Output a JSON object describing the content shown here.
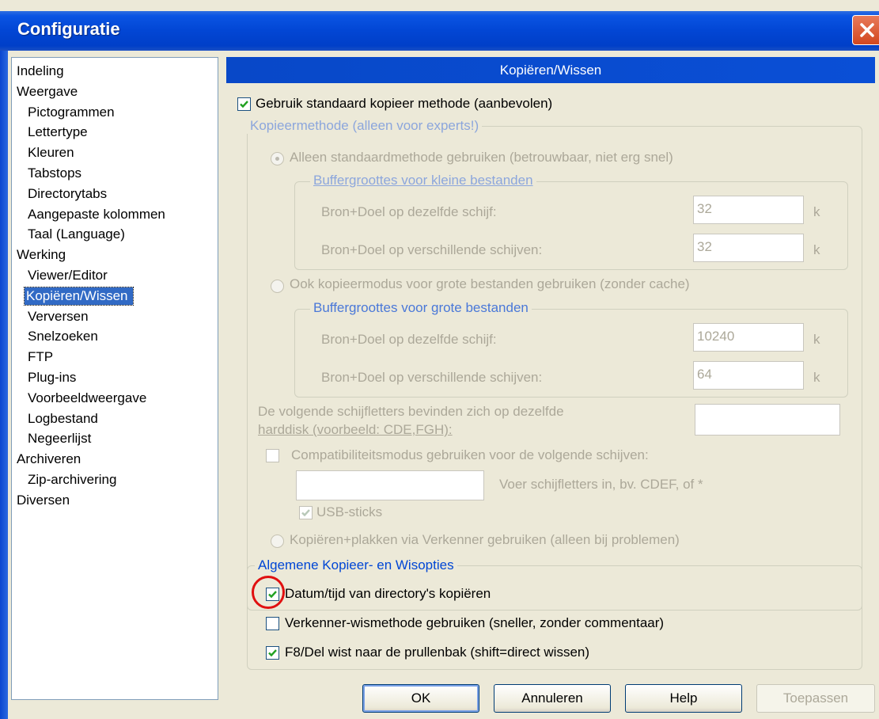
{
  "window": {
    "title": "Configuratie"
  },
  "tree": {
    "items": [
      {
        "label": "Indeling",
        "level": 0
      },
      {
        "label": "Weergave",
        "level": 0
      },
      {
        "label": "Pictogrammen",
        "level": 1
      },
      {
        "label": "Lettertype",
        "level": 1
      },
      {
        "label": "Kleuren",
        "level": 1
      },
      {
        "label": "Tabstops",
        "level": 1
      },
      {
        "label": "Directorytabs",
        "level": 1
      },
      {
        "label": "Aangepaste kolommen",
        "level": 1
      },
      {
        "label": "Taal (Language)",
        "level": 1
      },
      {
        "label": "Werking",
        "level": 0
      },
      {
        "label": "Viewer/Editor",
        "level": 1
      },
      {
        "label": "Kopiëren/Wissen",
        "level": 1,
        "selected": true
      },
      {
        "label": "Verversen",
        "level": 1
      },
      {
        "label": "Snelzoeken",
        "level": 1
      },
      {
        "label": "FTP",
        "level": 1
      },
      {
        "label": "Plug-ins",
        "level": 1
      },
      {
        "label": "Voorbeeldweergave",
        "level": 1
      },
      {
        "label": "Logbestand",
        "level": 1
      },
      {
        "label": "Negeerlijst",
        "level": 1
      },
      {
        "label": "Archiveren",
        "level": 0
      },
      {
        "label": "Zip-archivering",
        "level": 1
      },
      {
        "label": "Diversen",
        "level": 0
      }
    ]
  },
  "panel": {
    "header": "Kopiëren/Wissen",
    "use_standard_copy": {
      "label": "Gebruik standaard kopieer methode (aanbevolen)",
      "checked": true
    },
    "copy_method": {
      "legend": "Kopieermethode (alleen voor experts!)",
      "standard_only": "Alleen standaardmethode gebruiken (betrouwbaar, niet erg snel)",
      "small_buffers": {
        "legend": "Buffergroottes voor kleine bestanden",
        "same_disk_label": "Bron+Doel op dezelfde schijf:",
        "same_disk_value": "32",
        "diff_disk_label": "Bron+Doel op verschillende schijven:",
        "diff_disk_value": "32",
        "unit": "k"
      },
      "large_mode": "Ook kopieermodus voor grote bestanden gebruiken (zonder cache)",
      "large_buffers": {
        "legend": "Buffergroottes voor grote bestanden",
        "same_disk_label": "Bron+Doel op dezelfde schijf:",
        "same_disk_value": "10240",
        "diff_disk_label": "Bron+Doel op verschillende schijven:",
        "diff_disk_value": "64",
        "unit": "k"
      },
      "same_hd_line1": "De volgende schijfletters bevinden zich op dezelfde",
      "same_hd_line2": "harddisk (voorbeeld: CDE,FGH):",
      "same_hd_value": "",
      "compat_label": "Compatibiliteitsmodus gebruiken voor de volgende schijven:",
      "compat_value": "",
      "compat_hint": "Voer schijfletters in, bv. CDEF, of *",
      "usb_label": "USB-sticks",
      "explorer_paste": "Kopiëren+plakken via Verkenner gebruiken (alleen bij problemen)"
    },
    "general": {
      "legend": "Algemene Kopieer- en Wisopties",
      "dir_datetime": {
        "label": "Datum/tijd van directory's kopiëren",
        "checked": true
      },
      "explorer_delete": {
        "label": "Verkenner-wismethode gebruiken (sneller, zonder commentaar)",
        "checked": false
      },
      "f8_recycle": {
        "label": "F8/Del wist naar de prullenbak (shift=direct wissen)",
        "checked": true
      }
    }
  },
  "buttons": {
    "ok": "OK",
    "cancel": "Annuleren",
    "help": "Help",
    "apply": "Toepassen"
  }
}
